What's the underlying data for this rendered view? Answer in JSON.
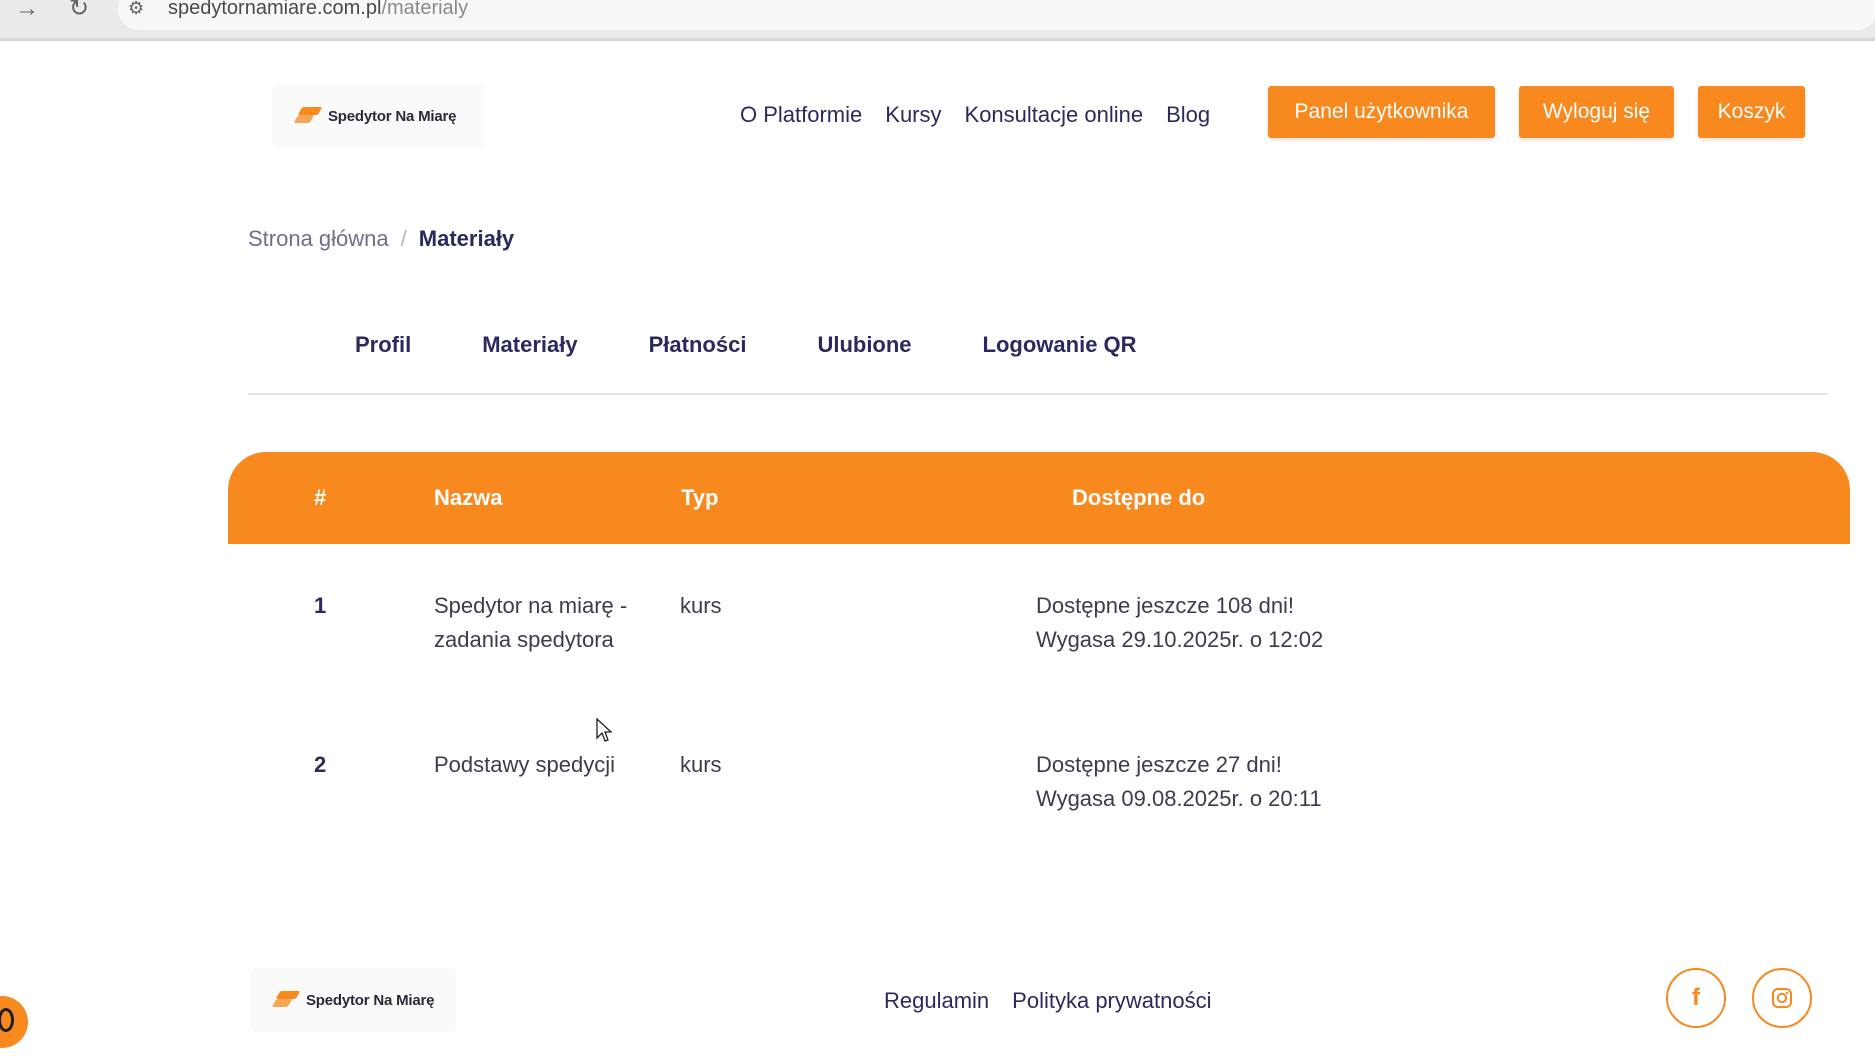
{
  "browser": {
    "url_host": "spedytornamiare.com.pl",
    "url_path": "/materialy"
  },
  "brand": {
    "name": "Spedytor Na Miarę"
  },
  "header": {
    "nav": [
      "O Platformie",
      "Kursy",
      "Konsultacje online",
      "Blog"
    ],
    "panel_label": "Panel użytkownika",
    "logout_label": "Wyloguj się",
    "cart_label": "Koszyk"
  },
  "breadcrumb": {
    "home": "Strona główna",
    "separator": "/",
    "current": "Materiały"
  },
  "tabs": [
    "Profil",
    "Materiały",
    "Płatności",
    "Ulubione",
    "Logowanie QR"
  ],
  "table": {
    "headers": {
      "num": "#",
      "name": "Nazwa",
      "type": "Typ",
      "available": "Dostępne do"
    },
    "rows": [
      {
        "num": "1",
        "name_line1": "Spedytor na miarę -",
        "name_line2": "zadania spedytora",
        "type": "kurs",
        "avail_line1": "Dostępne jeszcze 108 dni!",
        "avail_line2": "Wygasa 29.10.2025r. o 12:02"
      },
      {
        "num": "2",
        "name_line1": "Podstawy spedycji",
        "name_line2": "",
        "type": "kurs",
        "avail_line1": "Dostępne jeszcze 27 dni!",
        "avail_line2": "Wygasa 09.08.2025r. o 20:11"
      }
    ]
  },
  "footer": {
    "links": [
      "Regulamin",
      "Polityka prywatności"
    ],
    "social": [
      "facebook-icon",
      "instagram-icon"
    ]
  },
  "colors": {
    "accent": "#f7891f",
    "text": "#2b2a5e"
  }
}
